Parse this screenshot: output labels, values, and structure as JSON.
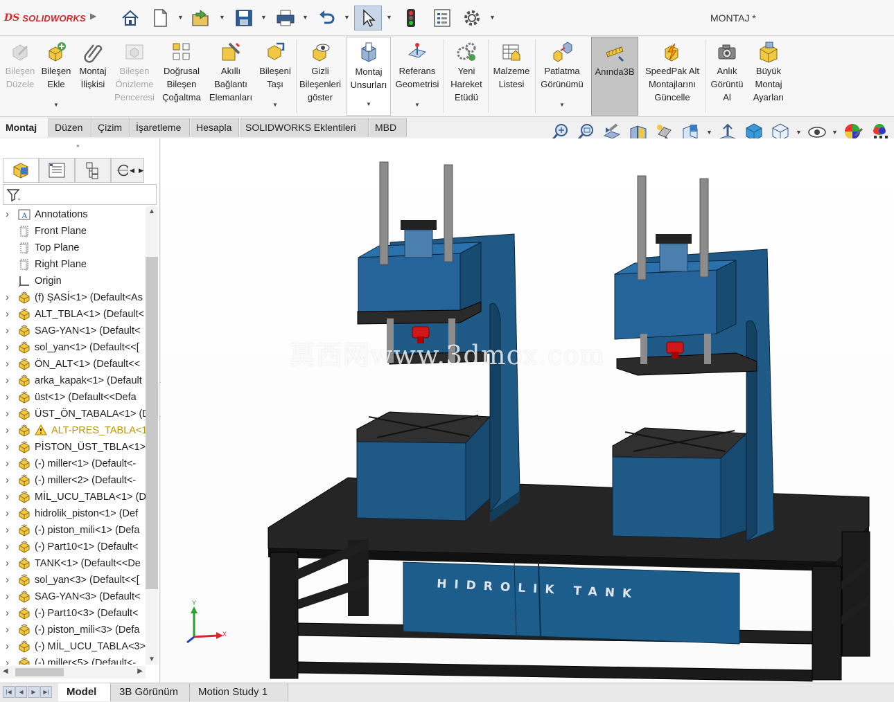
{
  "app": {
    "brand": "SOLIDWORKS",
    "logo_mark": "DS",
    "document_title": "MONTAJ *"
  },
  "quick_access": [
    {
      "name": "home-icon"
    },
    {
      "name": "new-document-icon"
    },
    {
      "name": "open-icon"
    },
    {
      "name": "save-icon"
    },
    {
      "name": "print-icon"
    },
    {
      "name": "undo-icon"
    },
    {
      "name": "select-icon"
    },
    {
      "name": "rebuild-icon"
    },
    {
      "name": "file-properties-icon"
    },
    {
      "name": "options-gear-icon"
    }
  ],
  "ribbon": {
    "bilesen_duzele": "Bileşen\nDüzele",
    "bilesen_ekle": "Bileşen\nEkle",
    "montaj_iliskisi": "Montaj\nİlişkisi",
    "bilesen_onizleme": "Bileşen\nÖnizleme\nPenceresi",
    "dogrusal": "Doğrusal\nBileşen\nÇoğaltma",
    "akilli": "Akıllı\nBağlantı\nElemanları",
    "bileseni_tasi": "Bileşeni\nTaşı",
    "gizli": "Gizli\nBileşenleri\ngöster",
    "montaj_unsurlari": "Montaj\nUnsurları",
    "referans": "Referans\nGeometrisi",
    "yeni_hareket": "Yeni\nHareket\nEtüdü",
    "malzeme": "Malzeme\nListesi",
    "patlatma": "Patlatma\nGörünümü",
    "aninda3b": "Anında3B",
    "speedpak": "SpeedPak Alt\nMontajlarını\nGüncelle",
    "anlik": "Anlık\nGörüntü\nAl",
    "buyuk": "Büyük\nMontaj\nAyarları"
  },
  "command_tabs": [
    "Montaj",
    "Düzen",
    "Çizim",
    "İşaretleme",
    "Hesapla",
    "SOLIDWORKS Eklentileri",
    "MBD"
  ],
  "view_tools": [
    "zoom-to-fit-icon",
    "zoom-area-icon",
    "previous-view-icon",
    "section-view-icon",
    "dynamic-annotation-icon",
    "view-orientation-icon",
    "display-style-icon",
    "hide-show-icon",
    "edit-appearance-icon",
    "apply-scene-icon",
    "view-settings-icon",
    "realview-icon",
    "display-icon"
  ],
  "feature_tree": [
    {
      "label": "Annotations",
      "type": "annotations",
      "expand": true
    },
    {
      "label": "Front Plane",
      "type": "plane",
      "expand": false
    },
    {
      "label": "Top Plane",
      "type": "plane",
      "expand": false
    },
    {
      "label": "Right Plane",
      "type": "plane",
      "expand": false
    },
    {
      "label": "Origin",
      "type": "origin",
      "expand": false
    },
    {
      "label": "(f) ŞASİ<1> (Default<As",
      "type": "part",
      "expand": true
    },
    {
      "label": "ALT_TBLA<1> (Default<",
      "type": "part",
      "expand": true
    },
    {
      "label": "SAG-YAN<1> (Default<",
      "type": "part",
      "expand": true
    },
    {
      "label": "sol_yan<1> (Default<<[",
      "type": "part",
      "expand": true
    },
    {
      "label": "ÖN_ALT<1> (Default<<",
      "type": "part",
      "expand": true
    },
    {
      "label": "arka_kapak<1> (Default",
      "type": "part",
      "expand": true
    },
    {
      "label": "üst<1> (Default<<Defa",
      "type": "part",
      "expand": true
    },
    {
      "label": "ÜST_ÖN_TABALA<1> (D",
      "type": "part",
      "expand": true
    },
    {
      "label": "ALT-PRES_TABLA<1",
      "type": "part-warning",
      "expand": true
    },
    {
      "label": "PİSTON_ÜST_TBLA<1> (",
      "type": "part",
      "expand": true
    },
    {
      "label": "(-) miller<1> (Default<-",
      "type": "part",
      "expand": true
    },
    {
      "label": "(-) miller<2> (Default<-",
      "type": "part",
      "expand": true
    },
    {
      "label": "MİL_UCU_TABLA<1> (D",
      "type": "part",
      "expand": true
    },
    {
      "label": "hidrolik_piston<1> (Def",
      "type": "part",
      "expand": true
    },
    {
      "label": "(-) piston_mili<1> (Defa",
      "type": "part",
      "expand": true
    },
    {
      "label": "(-) Part10<1> (Default<",
      "type": "part",
      "expand": true
    },
    {
      "label": "TANK<1> (Default<<De",
      "type": "part",
      "expand": true
    },
    {
      "label": "sol_yan<3> (Default<<[",
      "type": "part",
      "expand": true
    },
    {
      "label": "SAG-YAN<3> (Default<",
      "type": "part",
      "expand": true
    },
    {
      "label": "(-) Part10<3> (Default<",
      "type": "part",
      "expand": true
    },
    {
      "label": "(-) piston_mili<3> (Defa",
      "type": "part",
      "expand": true
    },
    {
      "label": "(-) MİL_UCU_TABLA<3>",
      "type": "part",
      "expand": true
    },
    {
      "label": "(-) miller<5> (Default<-",
      "type": "part",
      "expand": true
    }
  ],
  "viewport": {
    "watermark": "莫西网www.3dmox.com",
    "tank_label": "HIDROLIK TANK",
    "triad_x": "X",
    "triad_y": "Y"
  },
  "bottom_tabs": [
    "Model",
    "3B Görünüm",
    "Motion Study 1"
  ],
  "colors": {
    "press_blue": "#1f5a86",
    "table_black": "#1e1e1e",
    "tank_blue": "#1d5d8c",
    "red_part": "#d01818",
    "rod_gray": "#8c8c8c"
  }
}
